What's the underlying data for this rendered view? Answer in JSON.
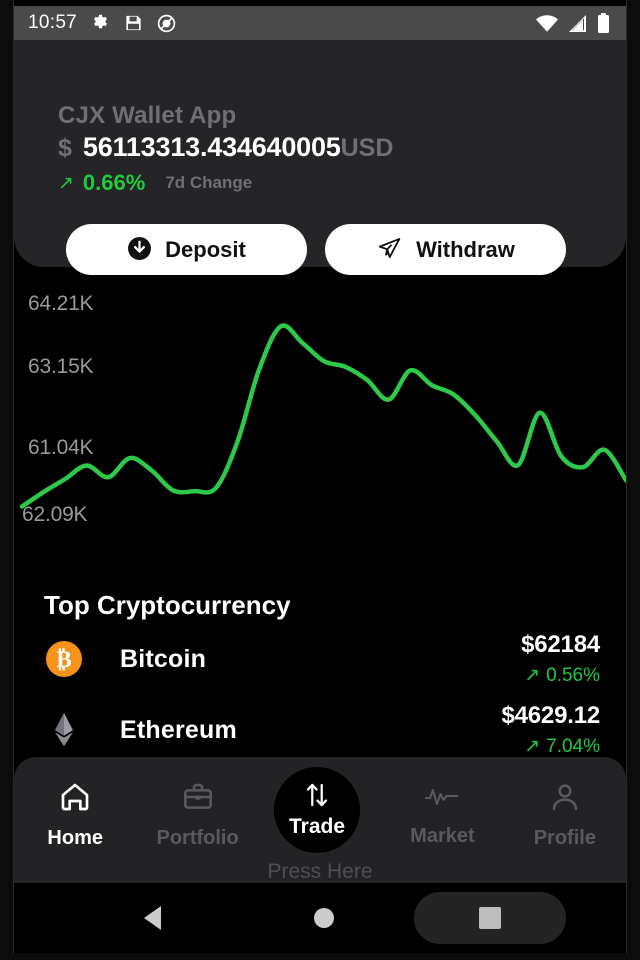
{
  "status_bar": {
    "time": "10:57",
    "left_icons": [
      "gear-icon",
      "save-disk-icon",
      "mute-circle-icon"
    ],
    "right_icons": [
      "wifi-icon",
      "cellular-signal-icon",
      "battery-icon"
    ]
  },
  "header": {
    "app_title": "CJX Wallet App",
    "currency_symbol": "$",
    "balance": "56113313.434640005",
    "currency_code": "USD",
    "change_arrow": "↗",
    "change_value": "0.66%",
    "change_label": "7d Change",
    "change_color": "#22c93f"
  },
  "actions": {
    "deposit_label": "Deposit",
    "withdraw_label": "Withdraw"
  },
  "chart_data": {
    "type": "line",
    "title": "",
    "xlabel": "",
    "ylabel": "",
    "line_color": "#2ec94a",
    "grid": false,
    "legend": "none",
    "y_tick_labels": [
      "64.21K",
      "63.15K",
      "61.04K",
      "62.09K"
    ],
    "y_tick_values": [
      64210,
      63150,
      61040,
      62090
    ],
    "ylim": [
      59900,
      64600
    ],
    "x": [
      0,
      1,
      2,
      3,
      4,
      5,
      6,
      7,
      8,
      9,
      10,
      11,
      12,
      13,
      14,
      15,
      16,
      17,
      18,
      19,
      20,
      21,
      22,
      23,
      24,
      25,
      26,
      27,
      28
    ],
    "values": [
      60050,
      60380,
      60680,
      60990,
      60720,
      61160,
      60880,
      60420,
      60400,
      60480,
      61550,
      63200,
      64180,
      63800,
      63380,
      63250,
      62950,
      62500,
      63170,
      62830,
      62620,
      62150,
      61550,
      61000,
      62200,
      61200,
      60950,
      61350,
      60650
    ]
  },
  "crypto_section": {
    "title": "Top Cryptocurrency",
    "items": [
      {
        "icon": "bitcoin-icon",
        "icon_color": "#f7931a",
        "name": "Bitcoin",
        "price": "$62184",
        "change_arrow": "↗",
        "change": "0.56%"
      },
      {
        "icon": "ethereum-icon",
        "icon_color": "#8a8d92",
        "name": "Ethereum",
        "price": "$4629.12",
        "change_arrow": "↗",
        "change": "7.04%"
      }
    ]
  },
  "bottom_nav": {
    "items": [
      {
        "icon": "home-icon",
        "label": "Home",
        "active": true
      },
      {
        "icon": "briefcase-icon",
        "label": "Portfolio",
        "active": false
      },
      {
        "icon": "market-pulse-icon",
        "label": "Market",
        "active": false
      },
      {
        "icon": "person-icon",
        "label": "Profile",
        "active": false
      }
    ],
    "fab": {
      "icon": "swap-arrows-icon",
      "label": "Trade"
    },
    "hint": "Press Here"
  },
  "android_nav": {
    "back": "back-triangle-icon",
    "home": "home-circle-icon",
    "recents": "recents-square-icon"
  }
}
